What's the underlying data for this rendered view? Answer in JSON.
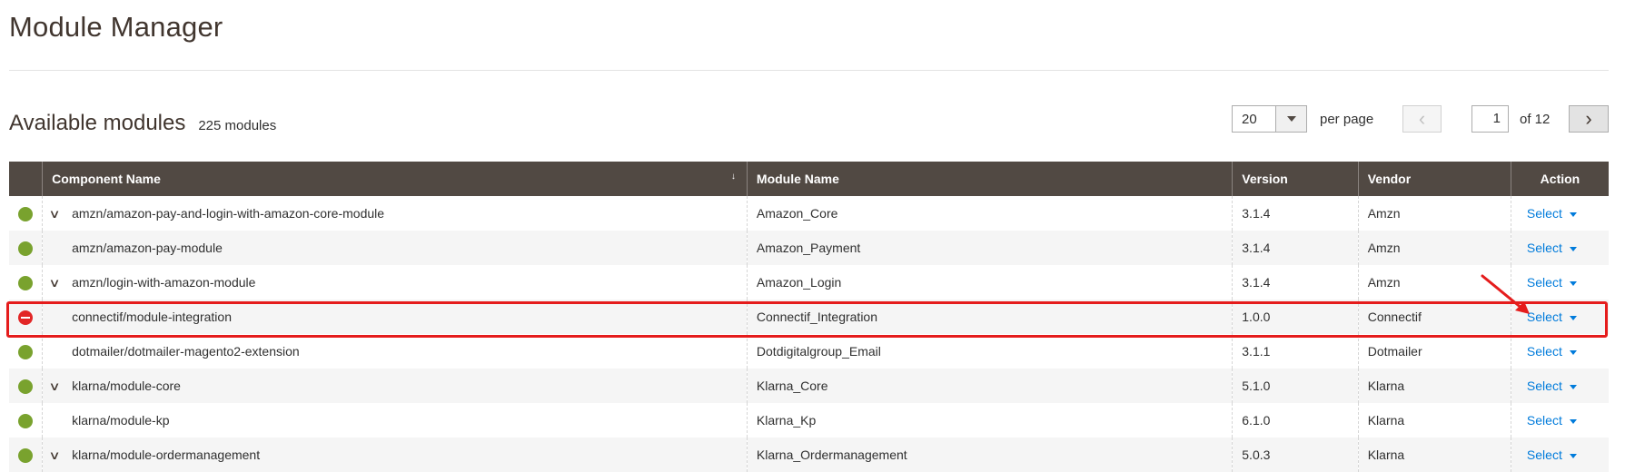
{
  "page": {
    "title": "Module Manager"
  },
  "section": {
    "title": "Available modules",
    "count": "225 modules"
  },
  "pager": {
    "per_page_value": "20",
    "per_page_label": "per page",
    "current_page": "1",
    "of_label": "of 12",
    "prev_glyph": "‹",
    "next_glyph": "›"
  },
  "table": {
    "headers": {
      "component": "Component Name",
      "module": "Module Name",
      "version": "Version",
      "vendor": "Vendor",
      "action": "Action"
    },
    "sort_indicator": "↓",
    "action_label": "Select",
    "rows": [
      {
        "status": "enabled",
        "expandable": true,
        "component": "amzn/amazon-pay-and-login-with-amazon-core-module",
        "module": "Amazon_Core",
        "version": "3.1.4",
        "vendor": "Amzn"
      },
      {
        "status": "enabled",
        "expandable": false,
        "component": "amzn/amazon-pay-module",
        "module": "Amazon_Payment",
        "version": "3.1.4",
        "vendor": "Amzn"
      },
      {
        "status": "enabled",
        "expandable": true,
        "component": "amzn/login-with-amazon-module",
        "module": "Amazon_Login",
        "version": "3.1.4",
        "vendor": "Amzn"
      },
      {
        "status": "disabled",
        "expandable": false,
        "component": "connectif/module-integration",
        "module": "Connectif_Integration",
        "version": "1.0.0",
        "vendor": "Connectif"
      },
      {
        "status": "enabled",
        "expandable": false,
        "component": "dotmailer/dotmailer-magento2-extension",
        "module": "Dotdigitalgroup_Email",
        "version": "3.1.1",
        "vendor": "Dotmailer"
      },
      {
        "status": "enabled",
        "expandable": true,
        "component": "klarna/module-core",
        "module": "Klarna_Core",
        "version": "5.1.0",
        "vendor": "Klarna"
      },
      {
        "status": "enabled",
        "expandable": false,
        "component": "klarna/module-kp",
        "module": "Klarna_Kp",
        "version": "6.1.0",
        "vendor": "Klarna"
      },
      {
        "status": "enabled",
        "expandable": true,
        "component": "klarna/module-ordermanagement",
        "module": "Klarna_Ordermanagement",
        "version": "5.0.3",
        "vendor": "Klarna"
      }
    ]
  },
  "colors": {
    "header_bg": "#514943",
    "status_enabled": "#79a22e",
    "status_disabled": "#e22626",
    "link": "#007bdb",
    "annotation": "#e51c1c"
  },
  "icons": {
    "status_enabled": "status-enabled-icon",
    "status_disabled": "status-disabled-icon",
    "expand": "chevron-down-icon",
    "dropdown": "caret-down-icon",
    "annotation_arrow": "arrow-icon"
  }
}
